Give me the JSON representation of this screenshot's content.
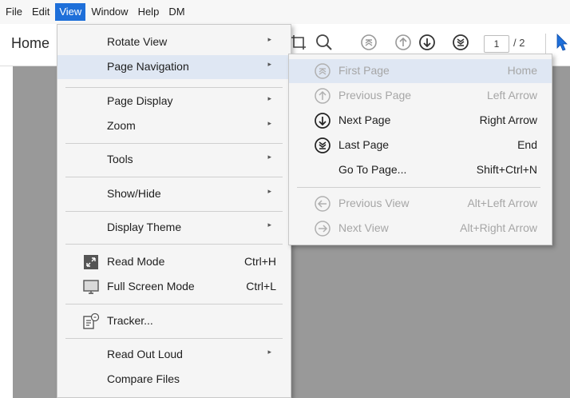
{
  "menubar": {
    "items": [
      "File",
      "Edit",
      "View",
      "Window",
      "Help",
      "DM"
    ]
  },
  "toolbar": {
    "home_label": "Home",
    "page_current": "1",
    "page_total": "/ 2"
  },
  "view_menu": {
    "items": [
      {
        "label": "Rotate View",
        "submenu": "▸"
      },
      {
        "label": "Page Navigation",
        "submenu": "▸"
      },
      {
        "label": "Page Display",
        "submenu": "▸"
      },
      {
        "label": "Zoom",
        "submenu": "▸"
      },
      {
        "label": "Tools",
        "submenu": "▸"
      },
      {
        "label": "Show/Hide",
        "submenu": "▸"
      },
      {
        "label": "Display Theme",
        "submenu": "▸"
      },
      {
        "label": "Read Mode",
        "shortcut": "Ctrl+H",
        "icon": "read-mode-icon"
      },
      {
        "label": "Full Screen Mode",
        "shortcut": "Ctrl+L",
        "icon": "full-screen-icon"
      },
      {
        "label": "Tracker...",
        "icon": "tracker-icon"
      },
      {
        "label": "Read Out Loud",
        "submenu": "▸"
      },
      {
        "label": "Compare Files"
      }
    ]
  },
  "page_nav_submenu": {
    "items": [
      {
        "label": "First Page",
        "shortcut": "Home",
        "enabled": false
      },
      {
        "label": "Previous Page",
        "shortcut": "Left Arrow",
        "enabled": false
      },
      {
        "label": "Next Page",
        "shortcut": "Right Arrow",
        "enabled": true
      },
      {
        "label": "Last Page",
        "shortcut": "End",
        "enabled": true
      },
      {
        "label": "Go To Page...",
        "shortcut": "Shift+Ctrl+N",
        "enabled": true
      },
      {
        "label": "Previous View",
        "shortcut": "Alt+Left Arrow",
        "enabled": false
      },
      {
        "label": "Next View",
        "shortcut": "Alt+Right Arrow",
        "enabled": false
      }
    ]
  },
  "colors": {
    "menu_highlight": "#1e6fd9",
    "page_background": "#999999",
    "menu_hover": "#dfe7f3"
  }
}
